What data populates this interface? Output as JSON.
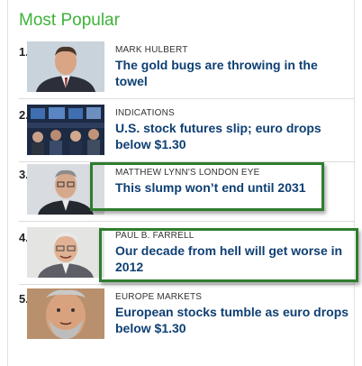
{
  "module": {
    "title": "Most Popular",
    "items": [
      {
        "rank": "1.",
        "kicker": "MARK HULBERT",
        "headline": "The gold bugs are throwing in the towel",
        "thumb": "portrait-man-suit-icon"
      },
      {
        "rank": "2.",
        "kicker": "INDICATIONS",
        "headline": "U.S. stock futures slip; euro drops below $1.30",
        "thumb": "trading-floor-icon"
      },
      {
        "rank": "3.",
        "kicker": "MATTHEW LYNN'S LONDON EYE",
        "headline": "This slump won’t end until 2031",
        "thumb": "portrait-man-glasses-icon"
      },
      {
        "rank": "4.",
        "kicker": "PAUL B. FARRELL",
        "headline": "Our decade from hell will get worse in 2012",
        "thumb": "portrait-older-man-icon"
      },
      {
        "rank": "5.",
        "kicker": "EUROPE MARKETS",
        "headline": "European stocks tumble as euro drops below $1.30",
        "thumb": "portrait-bearded-man-icon"
      }
    ]
  },
  "colors": {
    "title_green": "#3eb33a",
    "headline_blue": "#0e3f73",
    "highlight_green": "#2f7d2f"
  }
}
